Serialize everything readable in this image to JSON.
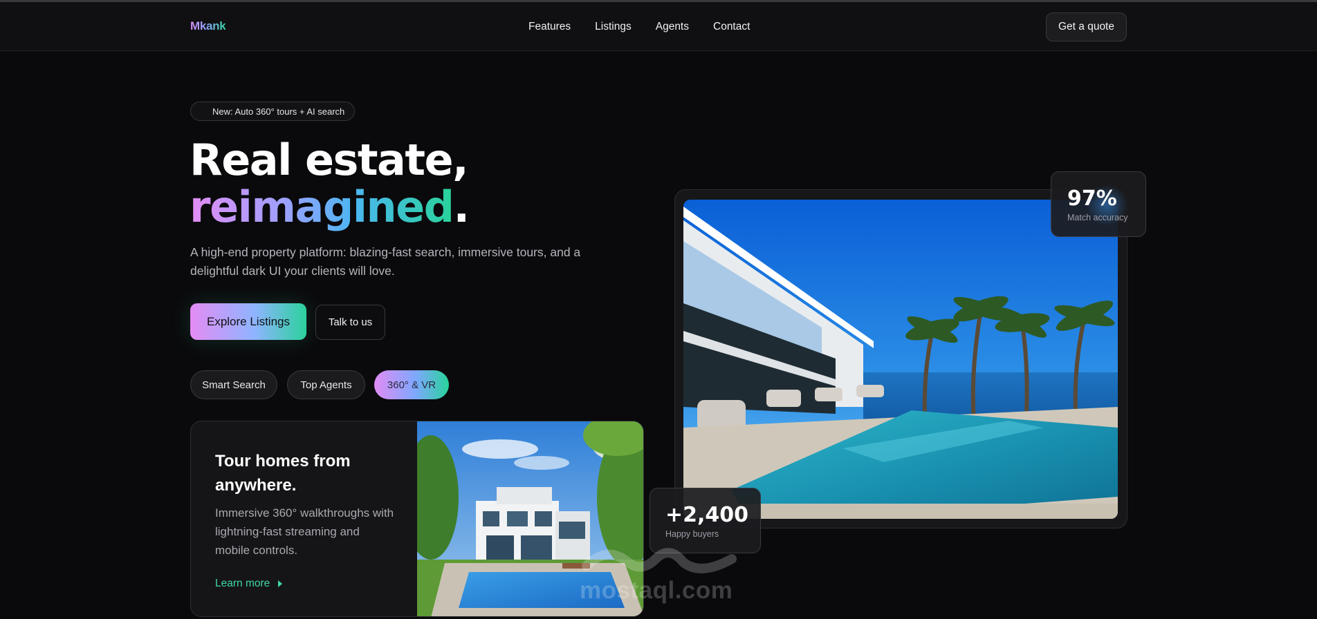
{
  "header": {
    "logo": "Mkank",
    "nav": [
      "Features",
      "Listings",
      "Agents",
      "Contact"
    ],
    "cta": "Get a quote"
  },
  "hero": {
    "badge": "New: Auto 360° tours + AI search",
    "title_line1": "Real estate,",
    "title_gradient": "reimagined",
    "title_period": ".",
    "subtitle": "A high-end property platform: blazing-fast search, immersive tours, and a delightful dark UI your clients will love.",
    "primary_button": "Explore Listings",
    "secondary_button": "Talk to us",
    "chips": [
      "Smart Search",
      "Top Agents",
      "360° & VR"
    ],
    "active_chip": "360° & VR"
  },
  "tour_card": {
    "title": "Tour homes from anywhere.",
    "text": "Immersive 360° walkthroughs with lightning-fast streaming and mobile controls.",
    "link": "Learn more"
  },
  "stats": {
    "accuracy_value": "97%",
    "accuracy_label": "Match accuracy",
    "buyers_value": "+2,400",
    "buyers_label": "Happy buyers"
  },
  "watermark": "mostaql.com",
  "colors": {
    "background": "#0a0a0c",
    "gradient_pink": "#e28df3",
    "gradient_blue": "#4cb6f2",
    "gradient_green": "#29d39a",
    "link_green": "#3fd6a6"
  }
}
